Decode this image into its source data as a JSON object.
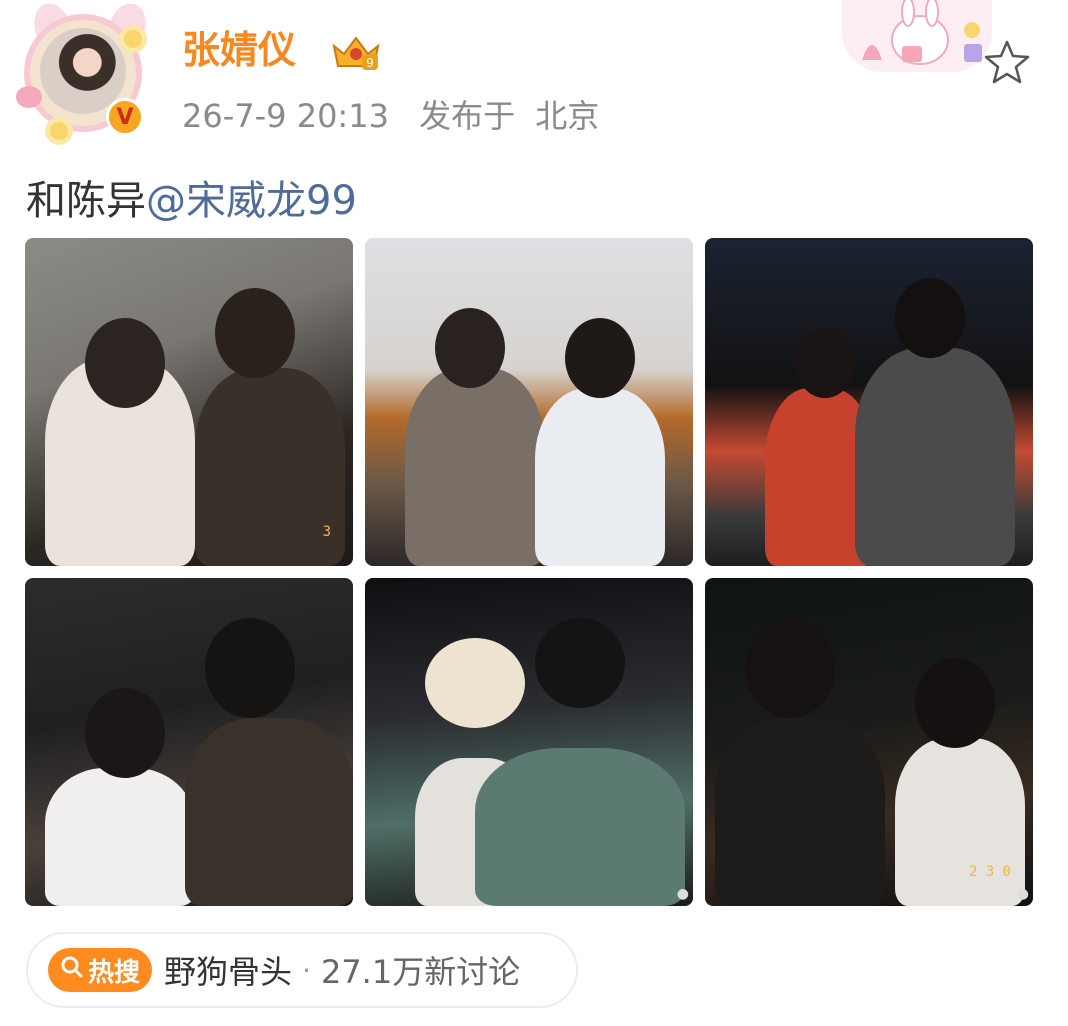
{
  "post": {
    "username": "张婧仪",
    "timestamp": "26-7-9 20:13",
    "location_prefix": "发布于",
    "location": "北京",
    "text_plain": "和陈异",
    "text_mention": "@宋威龙99"
  },
  "badges": {
    "verified": "V",
    "level": "9"
  },
  "photos": [
    {
      "alt": "photo-1"
    },
    {
      "alt": "photo-2"
    },
    {
      "alt": "photo-3"
    },
    {
      "alt": "photo-4"
    },
    {
      "alt": "photo-5"
    },
    {
      "alt": "photo-6"
    }
  ],
  "photo_stamps": {
    "photo1_stamp": "3",
    "photo6_stamp": "2 3 0"
  },
  "hot_search": {
    "badge_label": "热搜",
    "topic": "野狗骨头",
    "separator": "·",
    "count": "27.1万新讨论"
  },
  "colors": {
    "username": "#f7871f",
    "mention": "#4e6b9a",
    "hot_badge": "#ff8a1f",
    "meta_text": "#8a8a8a"
  },
  "icons": {
    "favorite": "star-outline-icon",
    "search": "search-icon",
    "verified": "verified-badge-icon",
    "crown": "crown-badge-icon"
  }
}
